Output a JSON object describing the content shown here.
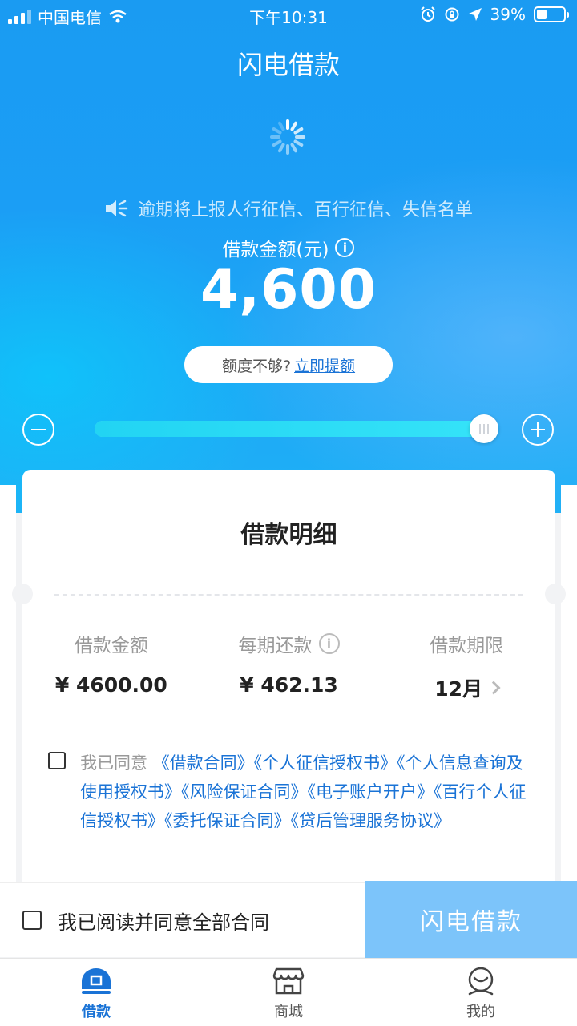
{
  "colors": {
    "brand": "#1a9bf2",
    "link": "#1a73d6",
    "button_disabled": "#7cc4fa"
  },
  "status_bar": {
    "carrier": "中国电信",
    "time": "下午10:31",
    "battery": "39%"
  },
  "header": {
    "title": "闪电借款"
  },
  "notice": {
    "icon": "speaker-icon",
    "text": "逾期将上报人行征信、百行征信、失信名单"
  },
  "loan": {
    "amount_label": "借款金额(元)",
    "amount": "4,600",
    "raise_prompt": "额度不够?",
    "raise_link": "立即提额",
    "slider_fraction": 1.0
  },
  "detail": {
    "title": "借款明细",
    "columns": [
      {
        "label": "借款金额",
        "value": "¥ 4600.00"
      },
      {
        "label": "每期还款",
        "value": "¥ 462.13"
      },
      {
        "label": "借款期限",
        "value": "12月"
      }
    ]
  },
  "agreement": {
    "prefix": "我已同意 ",
    "docs": "《借款合同》《个人征信授权书》《个人信息查询及使用授权书》《风险保证合同》《电子账户开户》《百行个人征信授权书》《委托保证合同》《贷后管理服务协议》"
  },
  "bottom": {
    "check_label": "我已阅读并同意全部合同",
    "submit_label": "闪电借款"
  },
  "tabs": [
    {
      "label": "借款",
      "icon": "loan-icon"
    },
    {
      "label": "商城",
      "icon": "store-icon"
    },
    {
      "label": "我的",
      "icon": "profile-icon"
    }
  ]
}
